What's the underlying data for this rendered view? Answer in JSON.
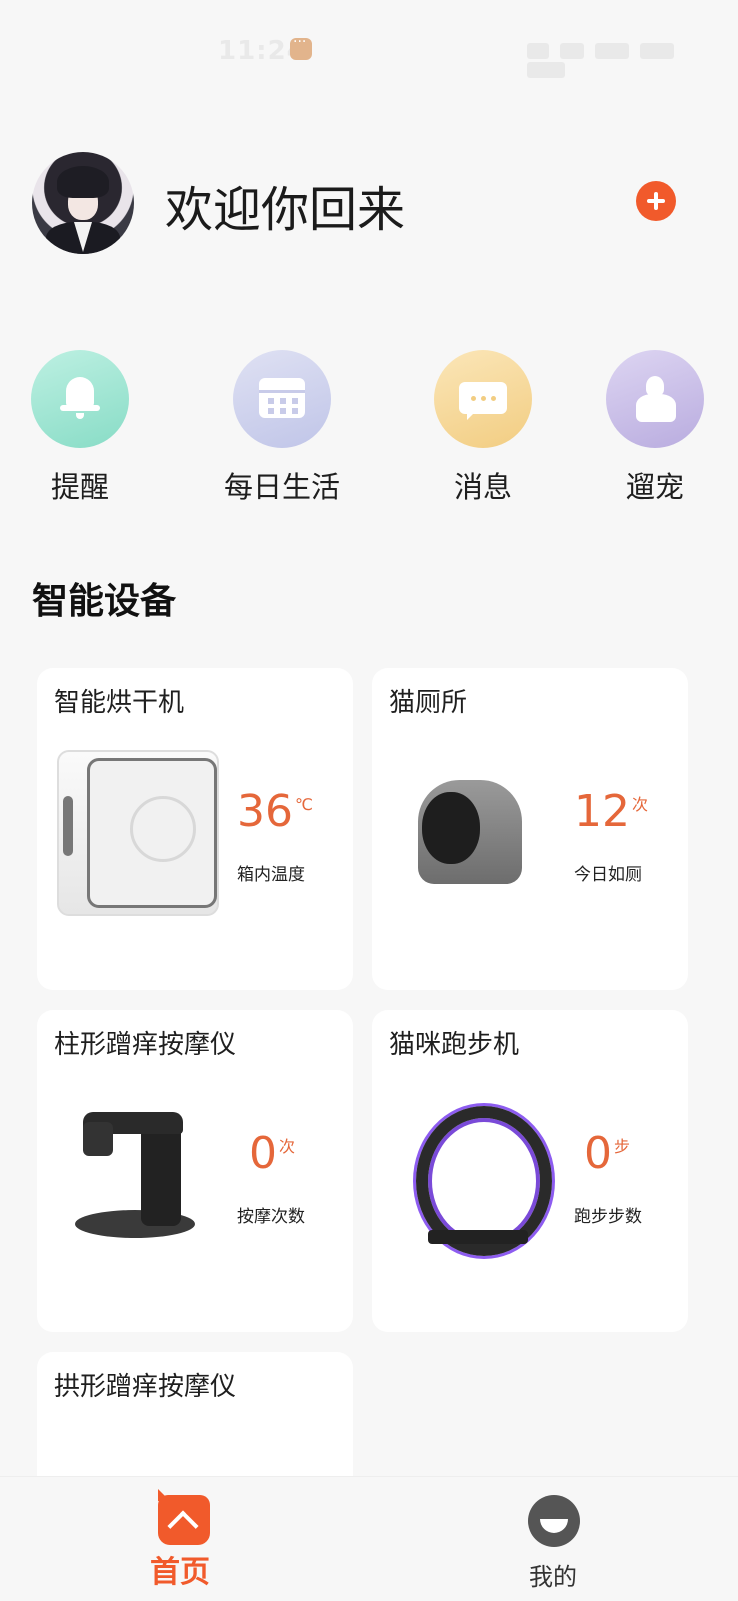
{
  "status_bar": {
    "time": "11:24"
  },
  "header": {
    "greeting": "欢迎你回来"
  },
  "quick_actions": [
    {
      "label": "提醒"
    },
    {
      "label": "每日生活"
    },
    {
      "label": "消息"
    },
    {
      "label": "遛宠"
    }
  ],
  "section": {
    "title": "智能设备"
  },
  "devices": [
    {
      "name": "智能烘干机",
      "value": "36",
      "unit": "℃",
      "caption": "箱内温度"
    },
    {
      "name": "猫厕所",
      "value": "12",
      "unit": "次",
      "caption": "今日如厕"
    },
    {
      "name": "柱形蹭痒按摩仪",
      "value": "0",
      "unit": "次",
      "caption": "按摩次数"
    },
    {
      "name": "猫咪跑步机",
      "value": "0",
      "unit": "步",
      "caption": "跑步步数"
    },
    {
      "name": "拱形蹭痒按摩仪"
    }
  ],
  "tabbar": {
    "home_label": "首页",
    "mine_label": "我的"
  },
  "colors": {
    "accent": "#f15a2b",
    "value": "#e5673a"
  }
}
